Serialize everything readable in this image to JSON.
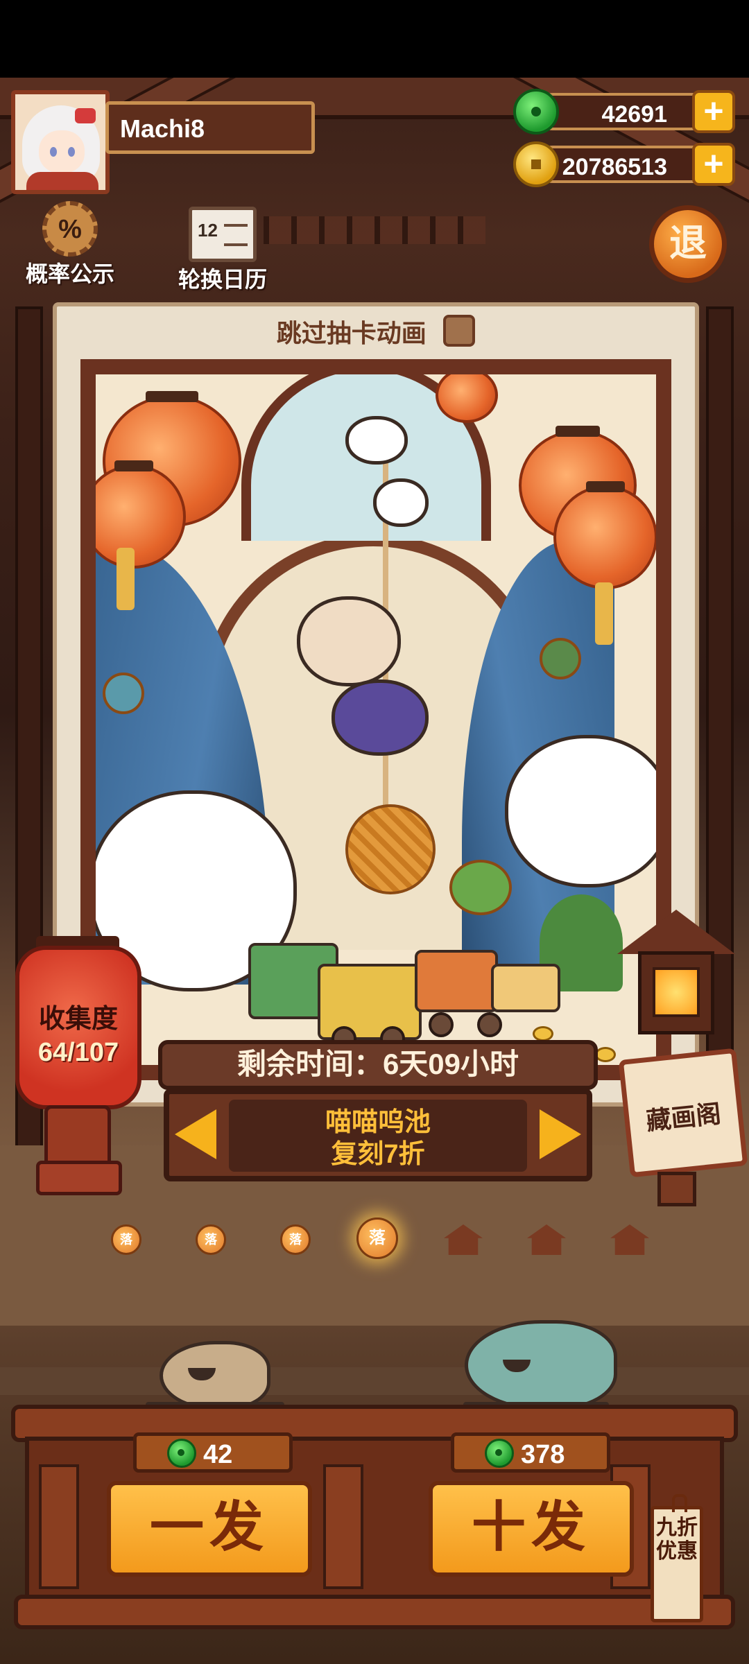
{
  "player": {
    "name": "Machi8"
  },
  "resources": {
    "jade": "42691",
    "gold": "20786513",
    "plus_symbol": "+"
  },
  "header_buttons": {
    "probability": "概率公示",
    "probability_symbol": "%",
    "rotation_calendar": "轮换日历",
    "calendar_number": "12",
    "exit": "退"
  },
  "card_frame": {
    "skip_label": "跳过抽卡动画",
    "skip_checked": false
  },
  "collection": {
    "label": "收集度",
    "value": "64/107"
  },
  "gallery_sign": {
    "label": "藏画阁"
  },
  "pool": {
    "remaining_time": "剩余时间：6天09小时",
    "name": "喵喵呜池",
    "subtitle": "复刻7折"
  },
  "page_indicators": {
    "lantern_glyph": "落",
    "items": [
      {
        "type": "lantern",
        "active": false
      },
      {
        "type": "lantern",
        "active": false
      },
      {
        "type": "lantern",
        "active": false
      },
      {
        "type": "lantern",
        "active": true
      },
      {
        "type": "house",
        "active": false
      },
      {
        "type": "house",
        "active": false
      },
      {
        "type": "house",
        "active": false
      }
    ]
  },
  "pulls": {
    "single": {
      "label": "一发",
      "cost": "42"
    },
    "ten": {
      "label": "十发",
      "cost": "378"
    },
    "discount_tag": "九折优惠"
  },
  "colors": {
    "accent_orange": "#f6b51c",
    "jade_green": "#1e9a2e",
    "wood_dark": "#3a1a10",
    "pool_text": "#ffbf3a"
  }
}
